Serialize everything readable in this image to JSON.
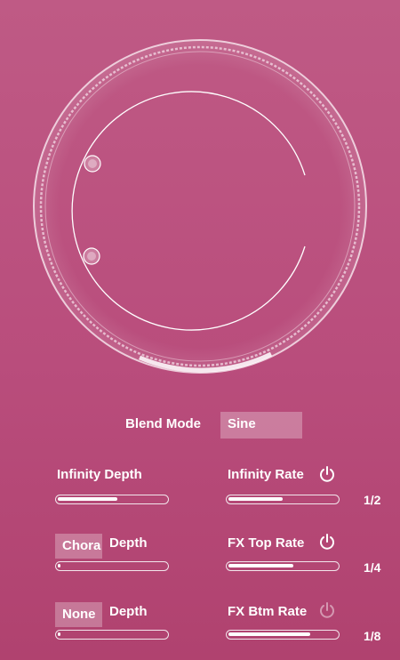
{
  "blend": {
    "label": "Blend Mode",
    "value": "Sine"
  },
  "infinity_depth": {
    "label": "Infinity Depth",
    "level": 0.55
  },
  "infinity_rate": {
    "label": "Infinity Rate",
    "value": "1/2",
    "level": 0.5,
    "power_on": true
  },
  "chorus_depth": {
    "selector": "Chora",
    "label": "Depth",
    "level": 0.02
  },
  "fx_top_rate": {
    "label": "FX Top Rate",
    "value": "1/4",
    "level": 0.6,
    "power_on": true
  },
  "none_depth": {
    "selector": "None",
    "label": "Depth",
    "level": 0.02
  },
  "fx_btm_rate": {
    "label": "FX Btm Rate",
    "value": "1/8",
    "level": 0.75,
    "power_on": false
  },
  "colors": {
    "background": "#b94d7c",
    "accent": "#ffffff"
  }
}
